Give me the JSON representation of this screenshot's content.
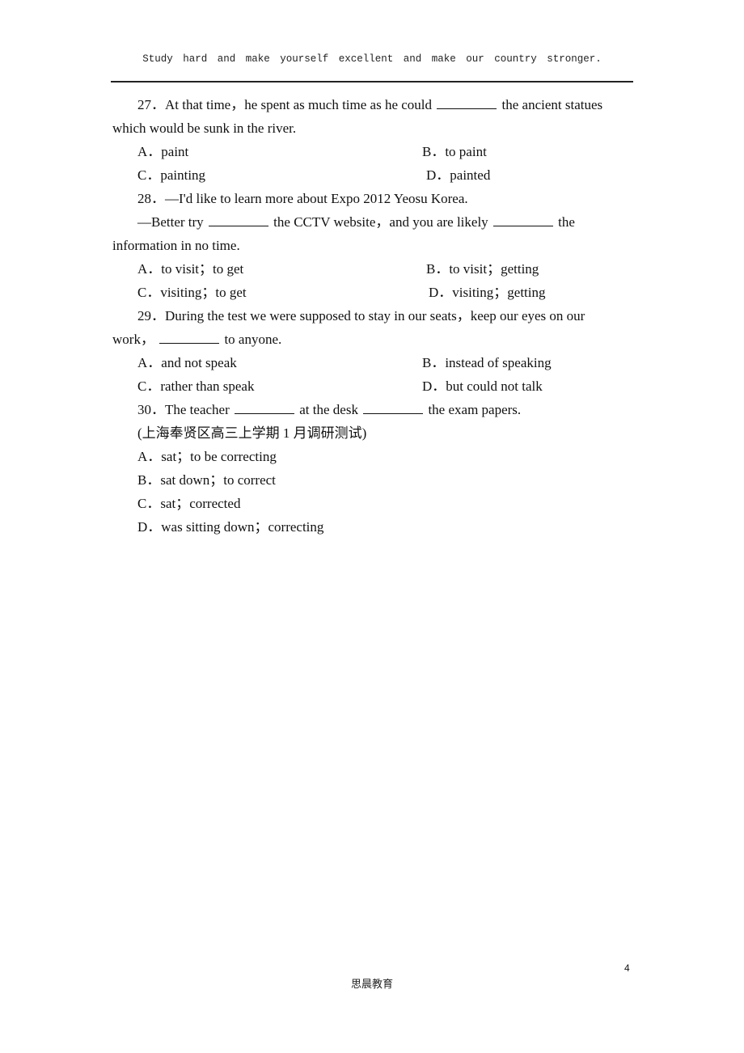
{
  "header": {
    "motto": "Study hard and make yourself excellent and make our country stronger."
  },
  "questions": [
    {
      "number": "27．",
      "line1_before": "At that time，he spent as much time as he could",
      "line1_after": "the ancient statues",
      "line2": "which would be sunk in the river.",
      "options": {
        "A": "A．paint",
        "B": "B．to paint",
        "C": "C．painting",
        "D": "D．painted"
      }
    },
    {
      "number": "28．",
      "line1": "—I'd like to learn more about Expo 2012 Yeosu Korea.",
      "line2_a": "—Better try",
      "line2_b": "the CCTV website，and you are likely",
      "line2_c": "the",
      "line3": "information in no time.",
      "options": {
        "A": "A．to visit；to get",
        "B": "B．to visit；getting",
        "C": "C．visiting；to get",
        "D": "D．visiting；getting"
      }
    },
    {
      "number": "29．",
      "line1": "During the test we were supposed to stay in our seats，keep our eyes on our",
      "line2_before": "work，",
      "line2_after": "to anyone.",
      "options": {
        "A": "A．and not speak",
        "B": "B．instead of speaking",
        "C": "C．rather than speak",
        "D": "D．but could not talk"
      }
    },
    {
      "number": "30．",
      "line1_a": "The teacher",
      "line1_b": "at the desk",
      "line1_c": "the exam papers.",
      "source": "(上海奉贤区高三上学期 1 月调研测试)",
      "options": {
        "A": "A．sat；to be correcting",
        "B": "B．sat down；to correct",
        "C": "C．sat；corrected",
        "D": "D．was sitting down；correcting"
      }
    }
  ],
  "footer": {
    "page_number": "4",
    "publisher": "思晨教育"
  }
}
